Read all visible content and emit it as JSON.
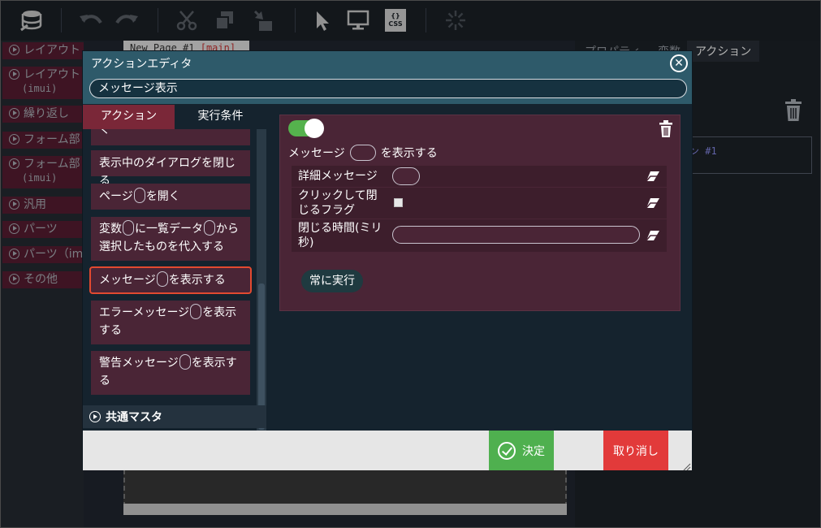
{
  "toolbar": {
    "icons": [
      "database-icon",
      "undo-icon",
      "redo-icon",
      "cut-icon",
      "copy-icon",
      "paste-icon",
      "pointer-icon",
      "monitor-icon",
      "css-icon",
      "loading-icon"
    ],
    "css_label_top": "{}",
    "css_label_bottom": "CSS"
  },
  "palette": {
    "items": [
      {
        "label": "レイアウト",
        "sub": ""
      },
      {
        "label": "レイアウト",
        "sub": "(imui)"
      },
      {
        "label": "繰り返し",
        "sub": ""
      },
      {
        "label": "フォーム部",
        "sub": ""
      },
      {
        "label": "フォーム部",
        "sub": "(imui)"
      },
      {
        "label": "汎用",
        "sub": ""
      },
      {
        "label": "パーツ",
        "sub": ""
      },
      {
        "label": "パーツ（im",
        "sub": ""
      },
      {
        "label": "その他",
        "sub": ""
      }
    ]
  },
  "canvas": {
    "tab_label": "New Page #1",
    "tab_tag": "[main]"
  },
  "right_panel": {
    "tabs": [
      "プロパティ",
      "変数",
      "アクション"
    ],
    "box_text": "ン #1"
  },
  "modal": {
    "title": "アクションエディタ",
    "action_name": "メッセージ表示",
    "tabs": {
      "action": "アクション",
      "condition": "実行条件"
    },
    "list": {
      "partial": "く",
      "items": [
        {
          "parts": [
            "表示中のダイアログを閉じる"
          ]
        },
        {
          "parts": [
            "ページ",
            "を開く"
          ]
        },
        {
          "parts": [
            "変数",
            "に一覧データ",
            "から選択したものを代入する"
          ]
        },
        {
          "parts": [
            "メッセージ",
            "を表示する"
          ]
        },
        {
          "parts": [
            "エラーメッセージ",
            "を表示する"
          ]
        },
        {
          "parts": [
            "警告メッセージ",
            "を表示する"
          ]
        }
      ]
    },
    "category": "共通マスタ",
    "detail": {
      "enabled": true,
      "message_prefix": "メッセージ",
      "message_suffix": "を表示する",
      "params": [
        {
          "label": "詳細メッセージ",
          "type": "text"
        },
        {
          "label": "クリックして閉じるフラグ",
          "type": "checkbox"
        },
        {
          "label": "閉じる時間(ミリ秒)",
          "type": "text"
        }
      ],
      "always_button": "常に実行"
    },
    "footer": {
      "ok": "決定",
      "cancel": "取り消し"
    }
  },
  "colors": {
    "accent": "#2e5a6a",
    "tab_active": "#7a2738",
    "ok": "#4fb04f",
    "cancel": "#e23a3a",
    "selected_border": "#e24a30",
    "toggle_on": "#55b24d"
  }
}
